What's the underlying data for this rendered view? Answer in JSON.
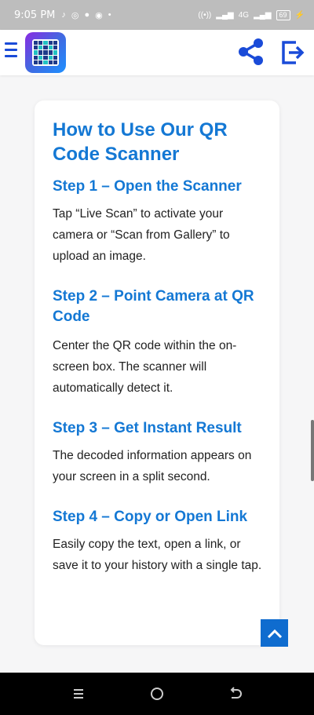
{
  "status": {
    "time": "9:05 PM",
    "notifications": [
      "tiktok-icon",
      "whatsapp-icon",
      "chat-icon",
      "chrome-icon",
      "dot-icon"
    ],
    "network": "4G",
    "battery": "69"
  },
  "header": {
    "logo_icon": "qr-code-logo",
    "share_icon": "share-icon",
    "exit_icon": "exit-icon"
  },
  "content": {
    "title": "How to Use Our QR Code Scanner",
    "steps": [
      {
        "title": "Step 1 – Open the Scanner",
        "text": "Tap “Live Scan” to activate your camera or “Scan from Gallery” to upload an image."
      },
      {
        "title": "Step 2 – Point Camera at QR Code",
        "text": "Center the QR code within the on-screen box. The scanner will automatically detect it."
      },
      {
        "title": "Step 3 – Get Instant Result",
        "text": "The decoded information appears on your screen in a split second."
      },
      {
        "title": "Step 4 – Copy or Open Link",
        "text": "Easily copy the text, open a link, or save it to your history with a single tap."
      }
    ]
  },
  "colors": {
    "accent": "#1478d4",
    "header_icons": "#1a4bd8",
    "top_button": "#0f6ccf"
  }
}
